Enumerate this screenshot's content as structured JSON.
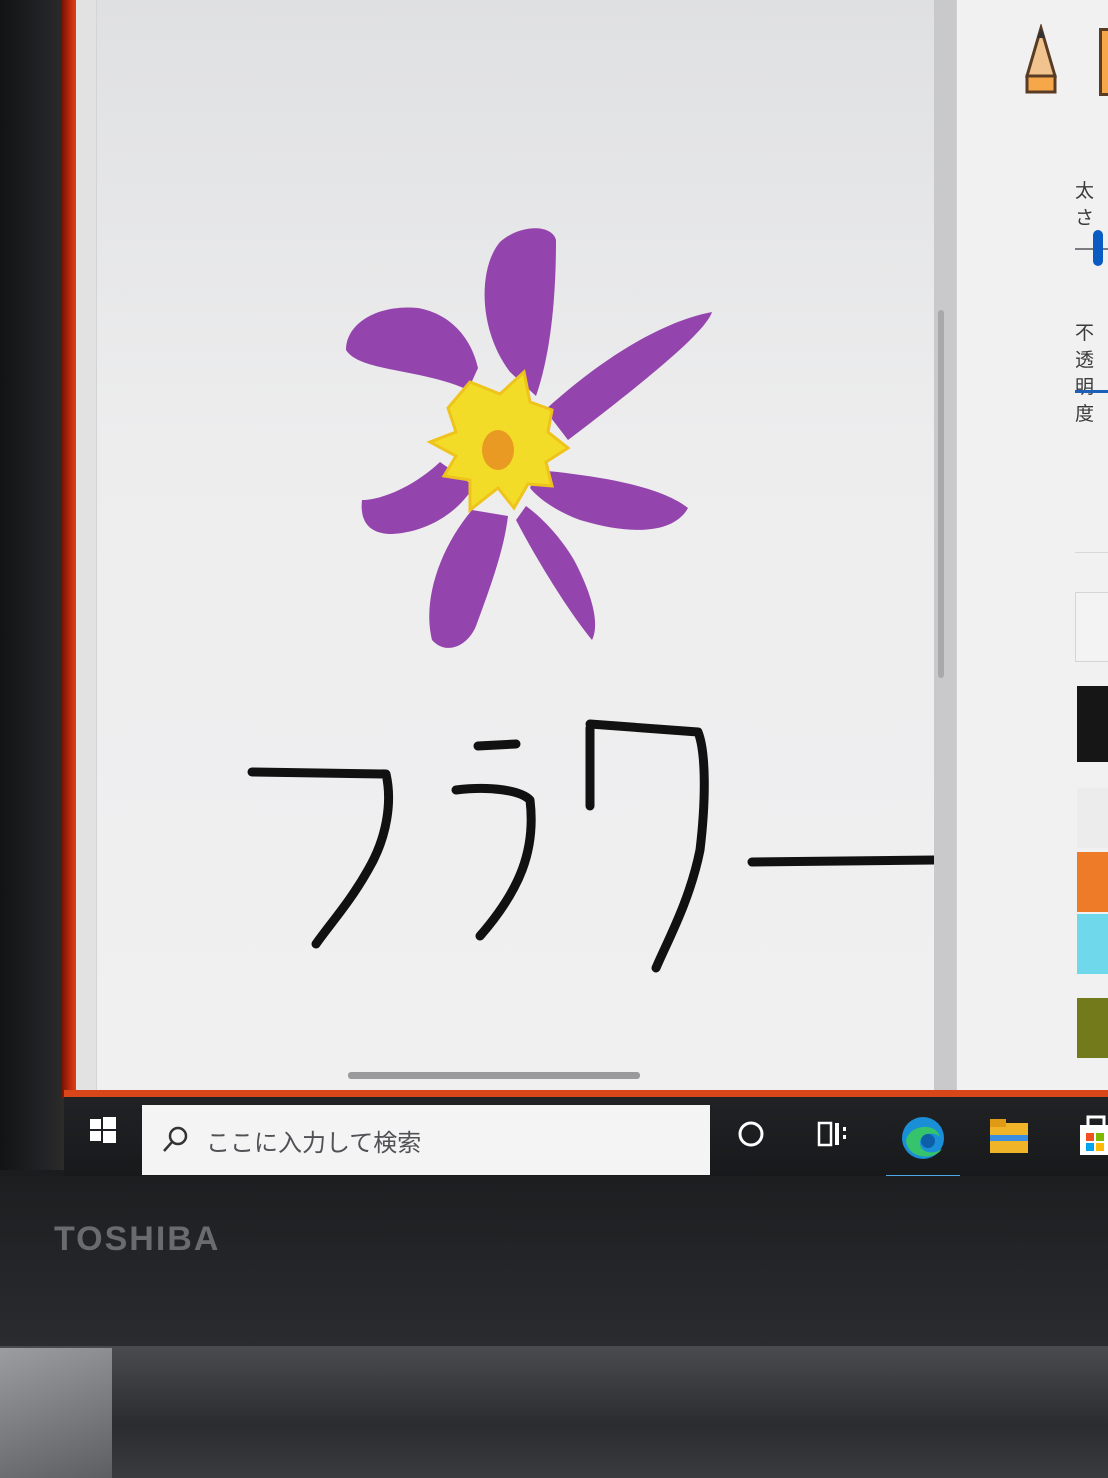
{
  "brand": "TOSHIBA",
  "paint_app": {
    "canvas": {
      "handwritten_text": "フラワー",
      "drawing": "flower"
    },
    "side_panel": {
      "thickness_label": "太さ",
      "opacity_label": "不透明度",
      "thickness_value_fraction": 0.1,
      "add_color_label": "+",
      "selected_color": "#161616",
      "palette": [
        "#ececed",
        "#b5b5b7",
        "#ee7b27",
        "#f2b928",
        "#6fd8ea",
        "#1690e8",
        "#737a1c"
      ]
    }
  },
  "taskbar": {
    "search_placeholder": "ここに入力して検索",
    "icons": [
      "windows-start-icon",
      "cortana-circle-icon",
      "task-view-icon",
      "edge-browser-icon",
      "file-explorer-icon",
      "store-icon"
    ]
  }
}
